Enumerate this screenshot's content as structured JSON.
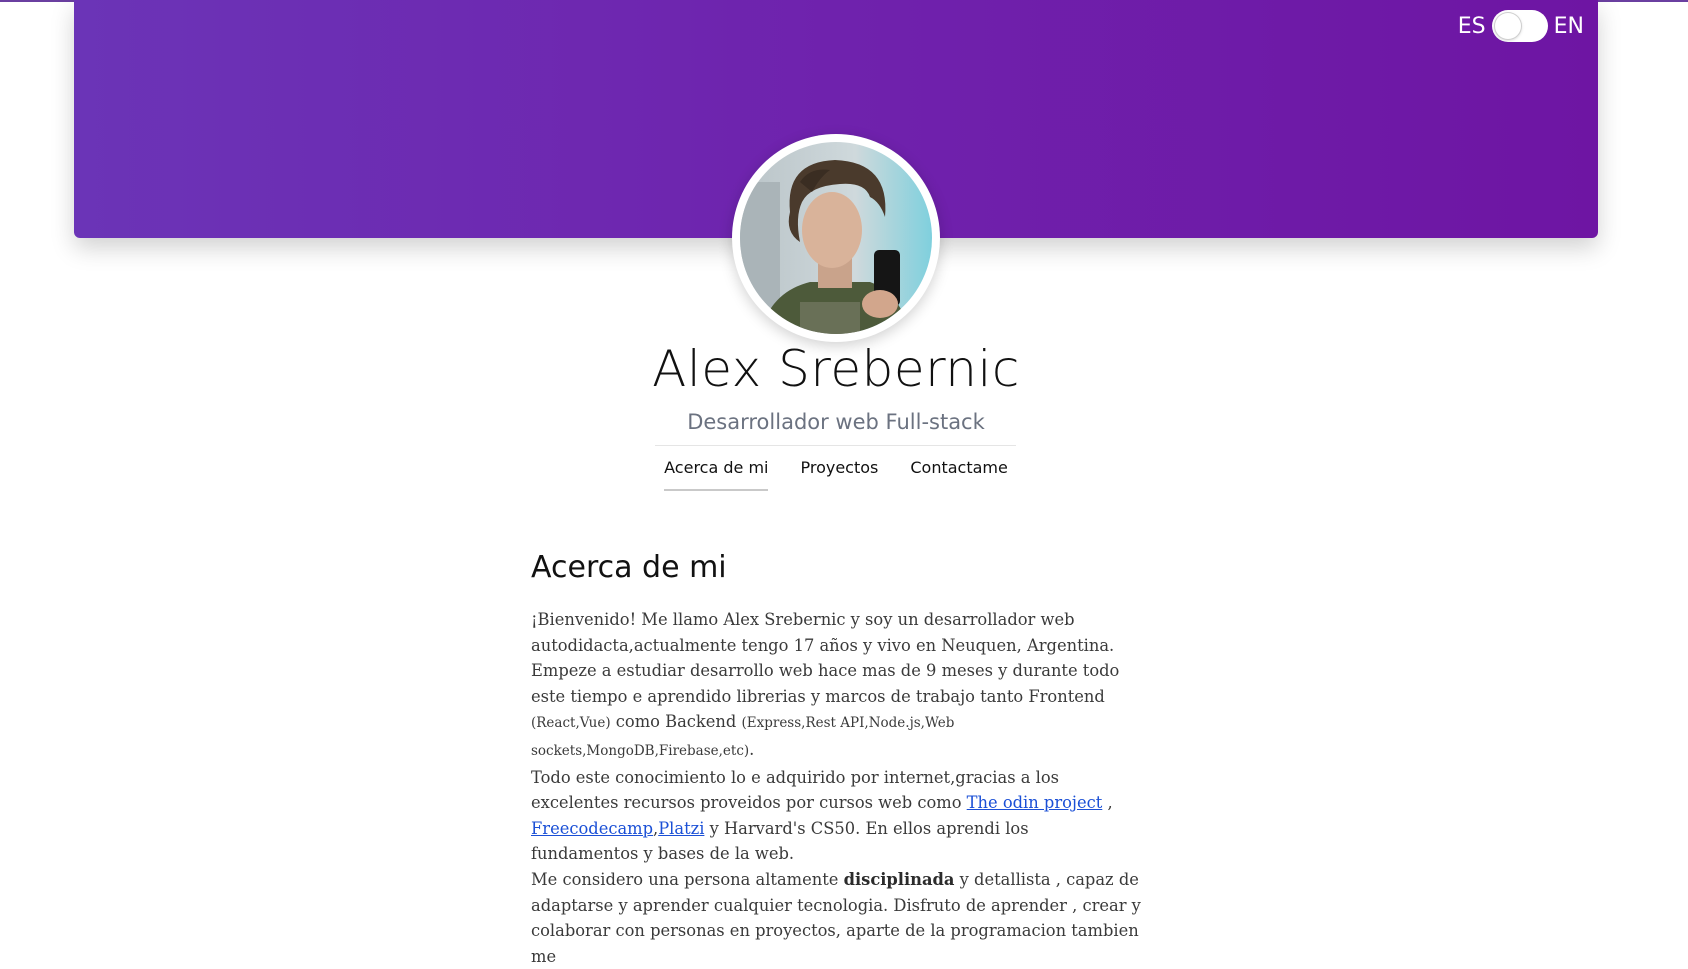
{
  "header": {
    "lang_es": "ES",
    "lang_en": "EN",
    "gradient": [
      "#6b34b7",
      "#6e15a3"
    ]
  },
  "profile": {
    "name": "Alex Srebernic",
    "role": "Desarrollador web Full-stack"
  },
  "nav": {
    "items": [
      "Acerca de mi",
      "Proyectos",
      "Contactame"
    ],
    "active": "Acerca de mi"
  },
  "about": {
    "title": "Acerca de mi",
    "p1_a": "¡Bienvenido! Me llamo Alex Srebernic y soy un desarrollador web autodidacta,actualmente tengo 17 años y vivo en Neuquen, Argentina.",
    "p2_a": "Empeze a estudiar desarrollo web hace mas de 9 meses y durante todo este tiempo e aprendido librerias y marcos de trabajo tanto Frontend ",
    "p2_small1": "(React,Vue)",
    "p2_b": " como Backend ",
    "p2_small2": "(Express,Rest API,Node.js,Web sockets,MongoDB,Firebase,etc)",
    "p2_c": ".",
    "p3_a": "Todo este conocimiento lo e adquirido por internet,gracias a los excelentes recursos proveidos por cursos web como ",
    "link_odin": "The odin project",
    "p3_sep1": " ,",
    "link_fcc": "Freecodecamp",
    "p3_sep2": ",",
    "link_platzi": "Platzi",
    "p3_b": " y Harvard's CS50. En ellos aprendi los fundamentos y bases de la web.",
    "p4_a": "Me considero una persona altamente ",
    "p4_bold": "disciplinada",
    "p4_b": " y detallista , capaz de adaptarse y aprender cualquier tecnologia. Disfruto de aprender , crear y colaborar con personas en proyectos, aparte de la programacion tambien me"
  }
}
